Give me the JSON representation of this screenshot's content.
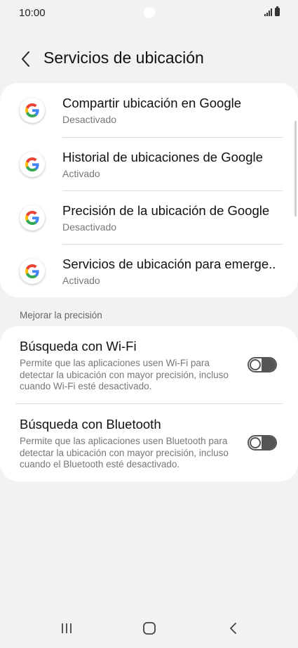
{
  "status_bar": {
    "time": "10:00"
  },
  "header": {
    "title": "Servicios de ubicación"
  },
  "google_services": [
    {
      "title": "Compartir ubicación en Google",
      "status": "Desactivado"
    },
    {
      "title": "Historial de ubicaciones de Google",
      "status": "Activado"
    },
    {
      "title": "Precisión de la ubicación de Google",
      "status": "Desactivado"
    },
    {
      "title": "Servicios de ubicación para emerge..",
      "status": "Activado"
    }
  ],
  "improve_section": {
    "header": "Mejorar la precisión",
    "items": [
      {
        "title": "Búsqueda con Wi-Fi",
        "description": "Permite que las aplicaciones usen Wi-Fi para detectar la ubicación con mayor precisión, incluso cuando Wi-Fi esté desactivado.",
        "enabled": false
      },
      {
        "title": "Búsqueda con Bluetooth",
        "description": "Permite que las aplicaciones usen Bluetooth para detectar la ubicación con mayor precisión, incluso cuando el Bluetooth esté desactivado.",
        "enabled": false
      }
    ]
  },
  "colors": {
    "background": "#f2f2f2",
    "card": "#ffffff",
    "google_blue": "#4285F4",
    "google_red": "#EA4335",
    "google_yellow": "#FBBC05",
    "google_green": "#34A853"
  },
  "icons": {
    "back": "chevron-left-icon",
    "google": "google-g-icon",
    "nav_recents": "recents-icon",
    "nav_home": "home-icon",
    "nav_back": "back-icon"
  }
}
